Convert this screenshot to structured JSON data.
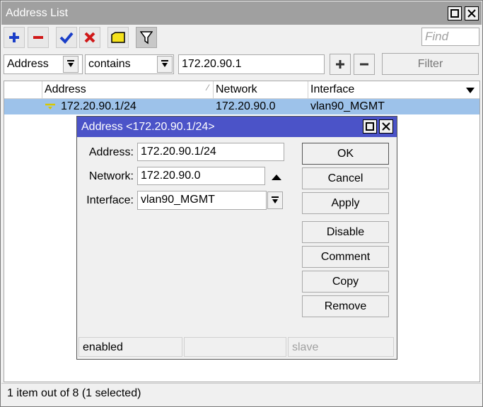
{
  "window": {
    "title": "Address List"
  },
  "toolbar": {
    "find_placeholder": "Find"
  },
  "filter": {
    "field": "Address",
    "operator": "contains",
    "value": "172.20.90.1",
    "button": "Filter"
  },
  "table": {
    "columns": [
      "Address",
      "Network",
      "Interface"
    ],
    "rows": [
      {
        "address": "172.20.90.1/24",
        "network": "172.20.90.0",
        "interface": "vlan90_MGMT"
      }
    ]
  },
  "status": "1 item out of 8 (1 selected)",
  "dialog": {
    "title": "Address <172.20.90.1/24>",
    "fields": {
      "address_label": "Address:",
      "address_value": "172.20.90.1/24",
      "network_label": "Network:",
      "network_value": "172.20.90.0",
      "interface_label": "Interface:",
      "interface_value": "vlan90_MGMT"
    },
    "buttons": {
      "ok": "OK",
      "cancel": "Cancel",
      "apply": "Apply",
      "disable": "Disable",
      "comment": "Comment",
      "copy": "Copy",
      "remove": "Remove"
    },
    "status": {
      "state": "enabled",
      "middle": "",
      "slave": "slave"
    }
  },
  "colors": {
    "window_title_bg": "#a0a0a0",
    "dialog_title_bg": "#4b53c8",
    "selected_row": "#9dc2ea"
  }
}
